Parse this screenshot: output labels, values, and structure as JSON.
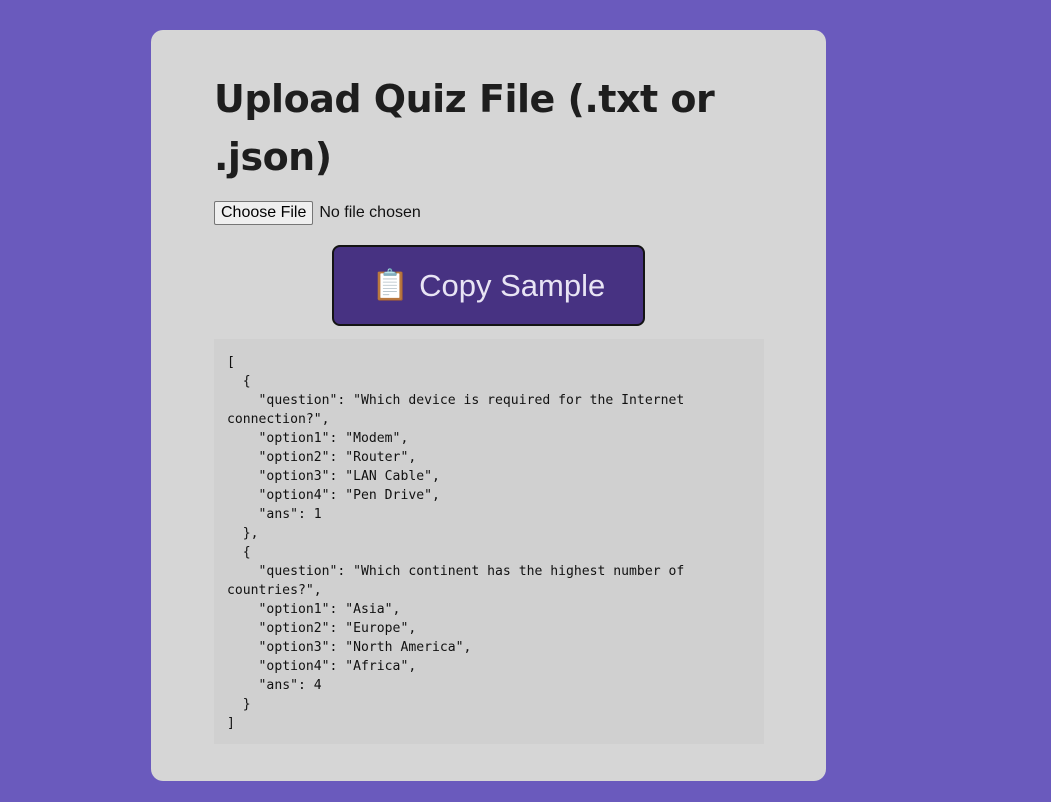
{
  "page": {
    "title": "Upload Quiz File (.txt or .json)"
  },
  "file_input": {
    "button_label": "Choose File",
    "status": "No file chosen"
  },
  "copy_button": {
    "icon": "clipboard-icon",
    "label": "Copy Sample"
  },
  "sample": {
    "code": "[\n  {\n    \"question\": \"Which device is required for the Internet connection?\",\n    \"option1\": \"Modem\",\n    \"option2\": \"Router\",\n    \"option3\": \"LAN Cable\",\n    \"option4\": \"Pen Drive\",\n    \"ans\": 1\n  },\n  {\n    \"question\": \"Which continent has the highest number of countries?\",\n    \"option1\": \"Asia\",\n    \"option2\": \"Europe\",\n    \"option3\": \"North America\",\n    \"option4\": \"Africa\",\n    \"ans\": 4\n  }\n]"
  },
  "colors": {
    "background": "#6a5abd",
    "card": "#d6d6d6",
    "button": "#473282",
    "code_bg": "#d0d0d0"
  }
}
